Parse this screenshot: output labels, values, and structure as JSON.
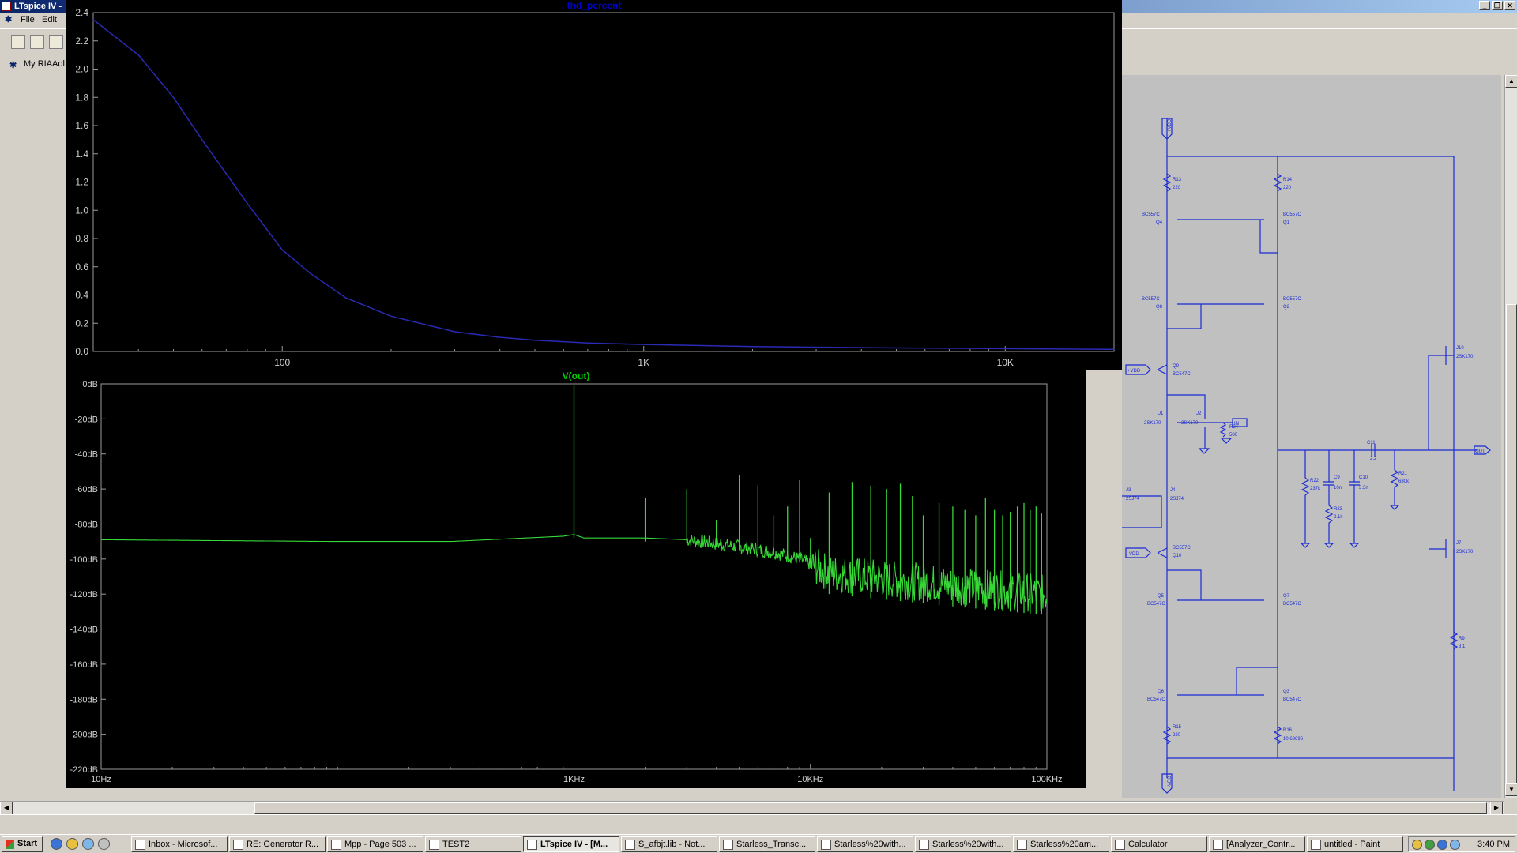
{
  "window": {
    "title": "LTspice IV -",
    "min": "_",
    "restore": "❐",
    "close": "✕"
  },
  "menu": {
    "file": "File",
    "edit": "Edit"
  },
  "tab": {
    "label": "My RIAAol"
  },
  "thd_plot": {
    "title": "thd_percent",
    "y_ticks": [
      "0.0",
      "0.2",
      "0.4",
      "0.6",
      "0.8",
      "1.0",
      "1.2",
      "1.4",
      "1.6",
      "1.8",
      "2.0",
      "2.2",
      "2.4"
    ],
    "x_ticks": [
      "100",
      "1K",
      "10K"
    ]
  },
  "fft_plot": {
    "title": "V(out)",
    "y_ticks": [
      "0dB",
      "-20dB",
      "-40dB",
      "-60dB",
      "-80dB",
      "-100dB",
      "-120dB",
      "-140dB",
      "-160dB",
      "-180dB",
      "-200dB",
      "-220dB"
    ],
    "x_ticks": [
      "10Hz",
      "1KHz",
      "10KHz",
      "100KHz"
    ]
  },
  "chart_data": [
    {
      "type": "line",
      "title": "thd_percent",
      "xlabel": "",
      "ylabel": "",
      "x_scale": "log",
      "xlim": [
        30,
        20000
      ],
      "ylim": [
        0,
        2.4
      ],
      "grid": false,
      "series": [
        {
          "x": [
            30,
            40,
            50,
            60,
            80,
            100,
            120,
            150,
            200,
            300,
            400,
            500,
            700,
            1000,
            2000,
            5000,
            10000,
            20000
          ],
          "y": [
            2.35,
            2.1,
            1.8,
            1.5,
            1.05,
            0.72,
            0.55,
            0.38,
            0.25,
            0.14,
            0.1,
            0.08,
            0.06,
            0.05,
            0.035,
            0.025,
            0.02,
            0.015
          ],
          "color": "#2a2ab4"
        }
      ]
    },
    {
      "type": "line",
      "title": "V(out)",
      "xlabel": "",
      "ylabel": "",
      "x_scale": "log",
      "xlim": [
        10,
        100000
      ],
      "ylim": [
        -220,
        0
      ],
      "grid": false,
      "series": [
        {
          "color": "#37d837",
          "baseline": [
            [
              10,
              -89
            ],
            [
              100,
              -90
            ],
            [
              300,
              -90
            ],
            [
              900,
              -87
            ],
            [
              1000,
              -86
            ],
            [
              1100,
              -88
            ],
            [
              2000,
              -88
            ],
            [
              3000,
              -89
            ],
            [
              5000,
              -93
            ],
            [
              7000,
              -96
            ],
            [
              9000,
              -100
            ],
            [
              10000,
              -103
            ],
            [
              12000,
              -108
            ],
            [
              20000,
              -111
            ],
            [
              40000,
              -115
            ],
            [
              100000,
              -120
            ]
          ],
          "harmonics_hz": [
            1000,
            2000,
            3000,
            4000,
            5000,
            6000,
            7000,
            8000,
            9000,
            10000,
            12000,
            15000,
            18000,
            21000,
            24000,
            27000,
            30000,
            35000,
            40000,
            45000,
            50000,
            55000,
            60000,
            65000,
            70000,
            75000,
            80000,
            85000,
            90000,
            95000
          ],
          "harmonics_db": [
            -1,
            -65,
            -60,
            -78,
            -52,
            -58,
            -75,
            -70,
            -55,
            -88,
            -62,
            -56,
            -58,
            -60,
            -57,
            -64,
            -75,
            -68,
            -70,
            -72,
            -75,
            -65,
            -72,
            -75,
            -73,
            -70,
            -68,
            -72,
            -70,
            -74
          ]
        }
      ]
    }
  ],
  "schematic": {
    "labels": {
      "vdd": "+VDD",
      "vdd_mid": "+VDD",
      "vdd_low": "-VDD",
      "vss": "-VDD",
      "in": "IN",
      "out": "OUT",
      "r13": "R13",
      "r13v": "220",
      "r14": "R14",
      "r14v": "220",
      "q4": "Q4",
      "q4m": "BC557C",
      "q1": "Q1",
      "q1m": "BC557C",
      "q8": "Q8",
      "q8m": "BC557C",
      "q2": "Q2",
      "q2m": "BC557C",
      "q9": "Q9",
      "q9m": "BC547C",
      "j1": "J1",
      "j1m": "2SK170",
      "j2": "J2",
      "j2m": "2SK170",
      "r24": "R24",
      "r24v": "500",
      "j3": "J3",
      "j3m": "2SJ74",
      "j4": "J4",
      "j4m": "2SJ74",
      "q10": "Q10",
      "q10m": "BC557C",
      "q5": "Q5",
      "q5m": "BC547C",
      "q7": "Q7",
      "q7m": "BC547C",
      "q6": "Q6",
      "q6m": "BC547C",
      "q3": "Q3",
      "q3m": "BC547C",
      "r15": "R15",
      "r15v": "220",
      "r16": "R16",
      "r16v": "10.68696",
      "r22": "R22",
      "r22v": "237k",
      "r23": "R23",
      "r23v": "2.1k",
      "c9": "C9",
      "c9v": "10n",
      "c10": "C10",
      "c10v": "3.3n",
      "c11": "C11",
      "c11v": "2.2",
      "r21": "R21",
      "r21v": "680k",
      "j10": "J10",
      "j10m": "2SK170",
      "j7": "J7",
      "j7m": "2SK170",
      "r9": "R9",
      "r9v": "3.1"
    }
  },
  "taskbar": {
    "start": "Start",
    "buttons": [
      "Inbox - Microsof...",
      "RE: Generator R...",
      "Mpp - Page 503 ...",
      "TEST2",
      "LTspice IV - [M...",
      "S_afbjt.lib - Not...",
      "Starless_Transc...",
      "Starless%20with...",
      "Starless%20with...",
      "Starless%20am...",
      "Calculator",
      "[Analyzer_Contr...",
      "untitled - Paint"
    ],
    "active_index": 4,
    "clock": "3:40 PM"
  },
  "colors": {
    "thd_trace": "#2a2ab4",
    "fft_trace": "#37d837",
    "schematic_wire": "#1b2bd4",
    "schematic_bg": "#c0c0c0"
  }
}
